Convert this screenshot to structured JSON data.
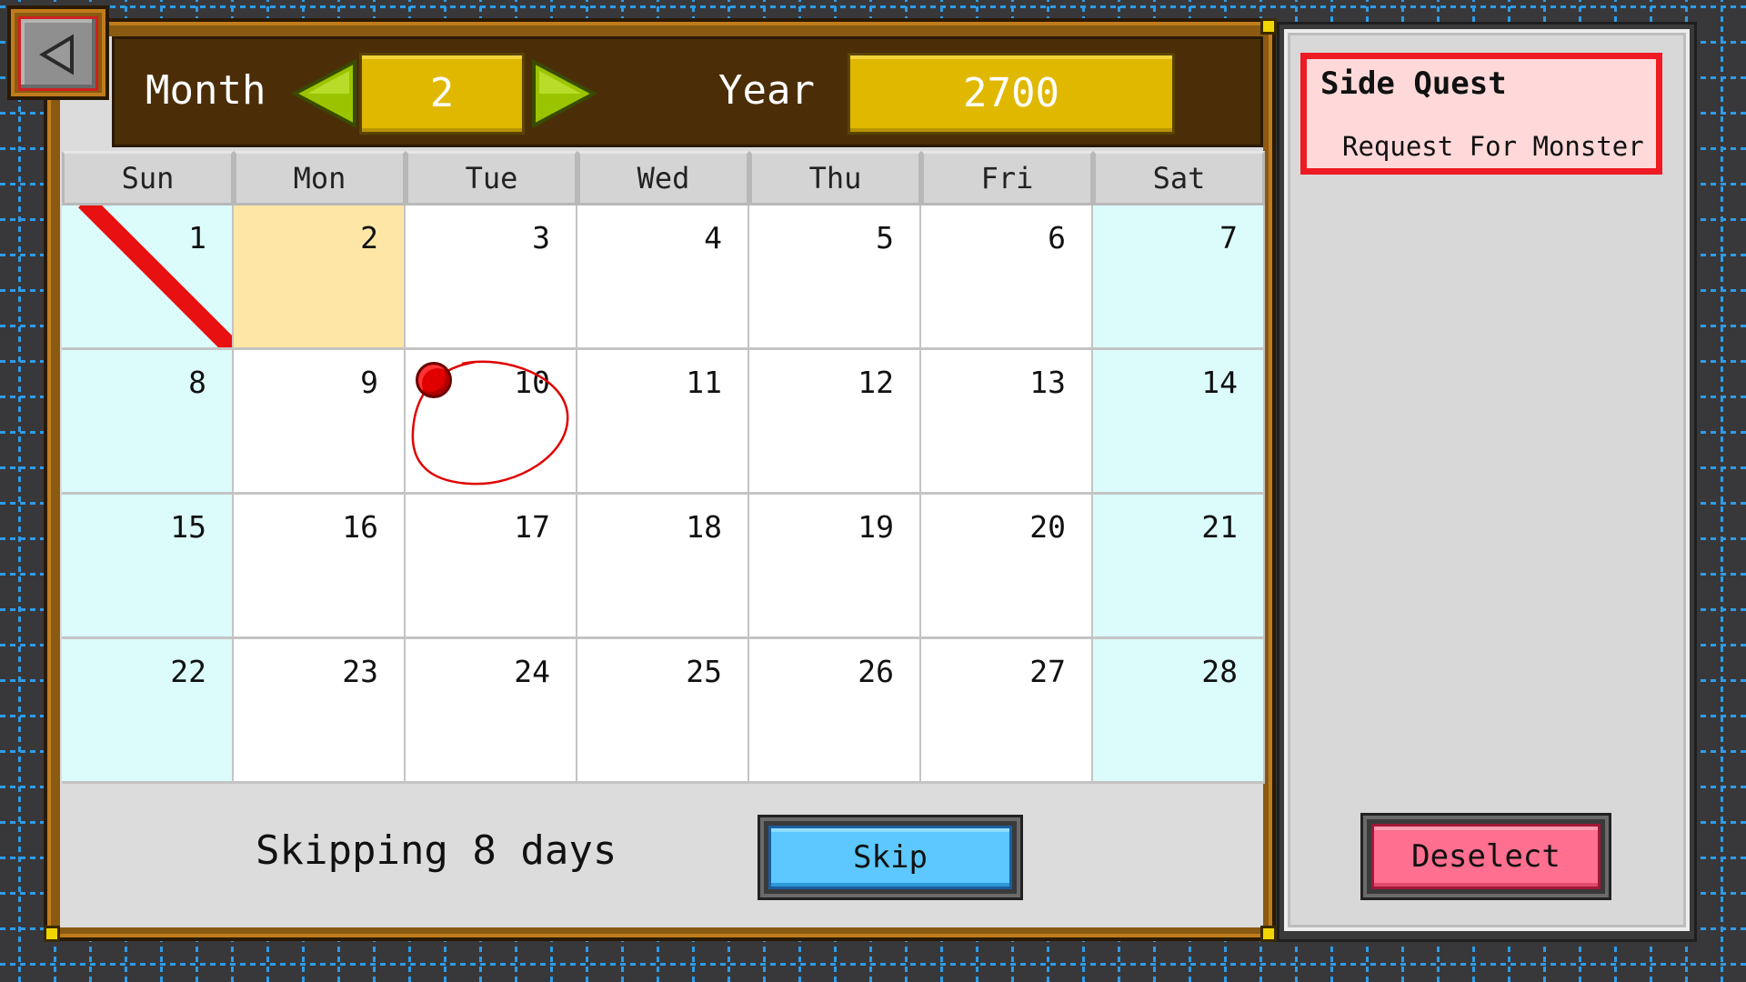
{
  "header": {
    "month_label": "Month",
    "month_value": "2",
    "year_label": "Year",
    "year_value": "2700"
  },
  "calendar": {
    "weekdays": [
      "Sun",
      "Mon",
      "Tue",
      "Wed",
      "Thu",
      "Fri",
      "Sat"
    ],
    "days": [
      "1",
      "2",
      "3",
      "4",
      "5",
      "6",
      "7",
      "8",
      "9",
      "10",
      "11",
      "12",
      "13",
      "14",
      "15",
      "16",
      "17",
      "18",
      "19",
      "20",
      "21",
      "22",
      "23",
      "24",
      "25",
      "26",
      "27",
      "28"
    ],
    "current_day": "1",
    "selected_day": "2",
    "marked_day": "10"
  },
  "footer": {
    "skip_status": "Skipping 8 days",
    "skip_label": "Skip"
  },
  "side_panel": {
    "quest_title": "Side Quest",
    "quest_name": "Request For Monster",
    "deselect_label": "Deselect"
  },
  "colors": {
    "frame_wood": "#8a5a12",
    "header_brown": "#4b2e08",
    "value_gold": "#e1b800",
    "arrow_green": "#9bc400",
    "weekend_cyan": "#dcfcfc",
    "selected_yellow": "#fde6a6",
    "mark_red": "#e00000",
    "skip_blue": "#5cc8ff",
    "deselect_pink": "#ff6f8f",
    "quest_border": "#ee1a24"
  },
  "icons": {
    "back": "back-triangle-icon",
    "prev_month": "arrow-left-icon",
    "next_month": "arrow-right-icon"
  }
}
